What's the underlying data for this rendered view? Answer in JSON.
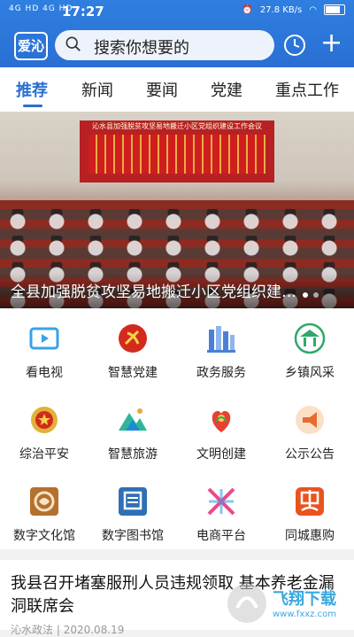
{
  "status_bar": {
    "signal_text": "4G HD 4G HD",
    "time": "17:27",
    "speed": "27.8 KB/s"
  },
  "toolbar": {
    "logo_text": "爱沁",
    "search_placeholder": "搜索你想要的"
  },
  "tabs": [
    {
      "label": "推荐",
      "active": true
    },
    {
      "label": "新闻",
      "active": false
    },
    {
      "label": "要闻",
      "active": false
    },
    {
      "label": "党建",
      "active": false
    },
    {
      "label": "重点工作",
      "active": false
    }
  ],
  "banner": {
    "stage_text": "沁水县加强脱贫攻坚易地搬迁小区党组织建设工作会议",
    "caption": "全县加强脱贫攻坚易地搬迁小区党组织建…",
    "slides": 2,
    "active_slide": 1
  },
  "services": [
    {
      "label": "看电视",
      "icon": "tv-icon",
      "color": "#3aa0e8"
    },
    {
      "label": "智慧党建",
      "icon": "party-emblem-icon",
      "color": "#d42a1e"
    },
    {
      "label": "政务服务",
      "icon": "government-building-icon",
      "color": "#4a7fd8"
    },
    {
      "label": "乡镇风采",
      "icon": "pavilion-icon",
      "color": "#2fa86a"
    },
    {
      "label": "综治平安",
      "icon": "police-badge-icon",
      "color": "#e0b23a"
    },
    {
      "label": "智慧旅游",
      "icon": "mountain-icon",
      "color": "#2fb59a"
    },
    {
      "label": "文明创建",
      "icon": "civilization-heart-icon",
      "color": "#e8412f"
    },
    {
      "label": "公示公告",
      "icon": "megaphone-icon",
      "color": "#e86a2f"
    },
    {
      "label": "数字文化馆",
      "icon": "culture-seal-icon",
      "color": "#b5702d"
    },
    {
      "label": "数字图书馆",
      "icon": "library-icon",
      "color": "#2f6fb5"
    },
    {
      "label": "电商平台",
      "icon": "ecommerce-icon",
      "color": "#e84b8a"
    },
    {
      "label": "同城惠购",
      "icon": "hui-discount-icon",
      "color": "#e8541e"
    }
  ],
  "news": {
    "title": "我县召开堵塞服刑人员违规领取 基本养老金漏洞联席会",
    "source": "沁水政法",
    "date": "2020.08.19"
  },
  "watermark": {
    "text": "飞翔下载",
    "url": "www.fxxz.com"
  }
}
